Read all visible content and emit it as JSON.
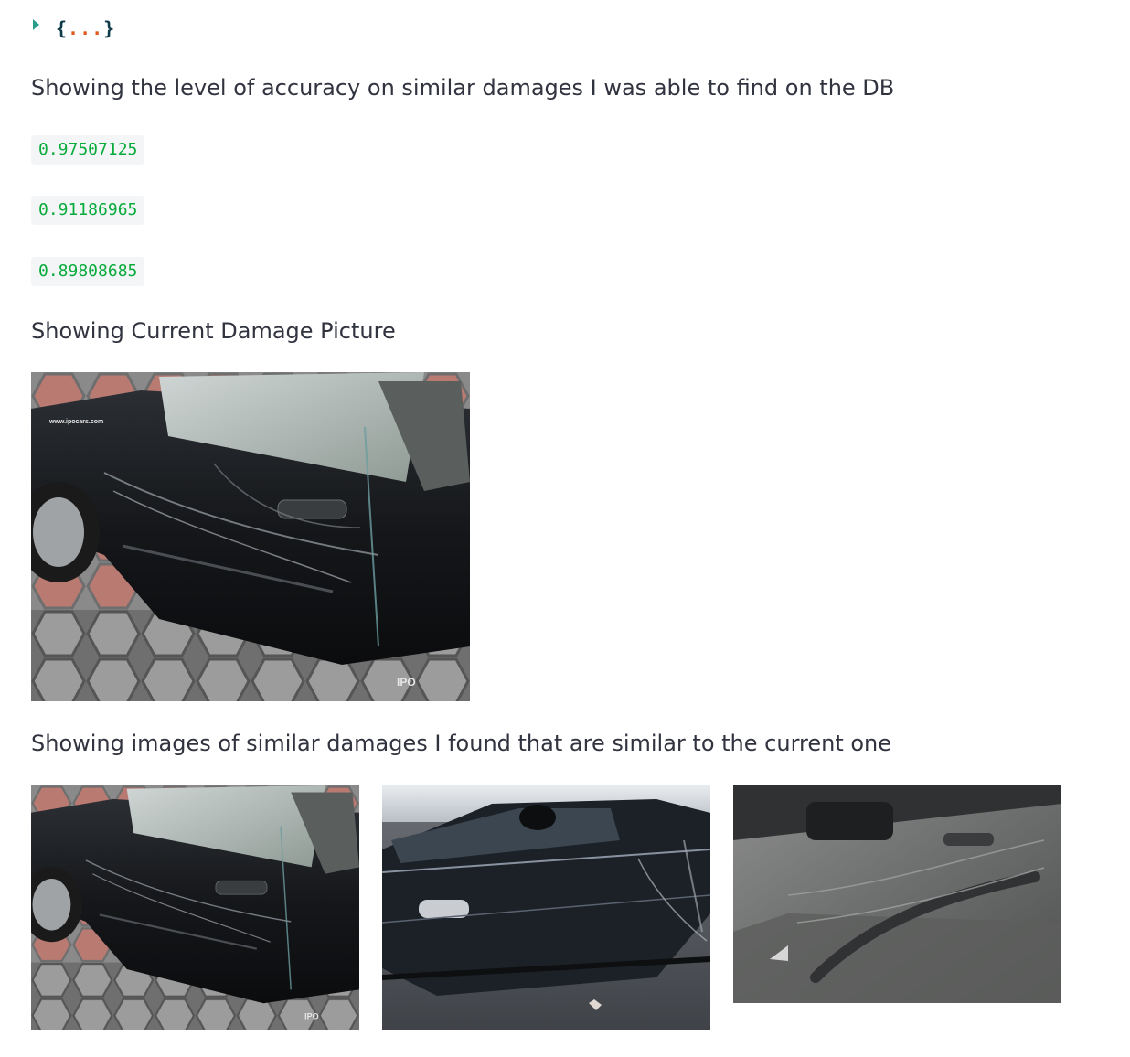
{
  "json_widget": {
    "open": "{",
    "dots": "...",
    "close": "}"
  },
  "texts": {
    "accuracy_heading": "Showing the level of accuracy on similar damages I was able to find on the DB",
    "current_heading": "Showing Current Damage Picture",
    "similar_heading": "Showing images of similar damages I found that are similar to the current one"
  },
  "scores": [
    "0.97507125",
    "0.91186965",
    "0.89808685"
  ],
  "images": {
    "current": {
      "watermark": "IPO",
      "watermark_url": "www.ipocars.com"
    },
    "similar_1_watermark": "IPO"
  },
  "colors": {
    "score_text": "#09ab3b",
    "code_bg": "#f3f5f7",
    "caret": "#2a9d8f",
    "dots": "#e0591f"
  }
}
